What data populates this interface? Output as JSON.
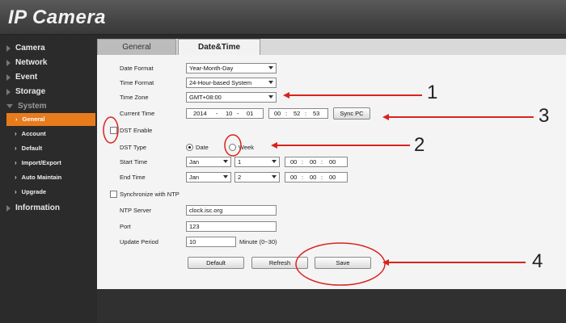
{
  "app": {
    "title": "IP Camera"
  },
  "sidebar": {
    "items": [
      {
        "label": "Camera"
      },
      {
        "label": "Network"
      },
      {
        "label": "Event"
      },
      {
        "label": "Storage"
      },
      {
        "label": "System"
      },
      {
        "label": "Information"
      }
    ],
    "sub_items": [
      {
        "label": "General"
      },
      {
        "label": "Account"
      },
      {
        "label": "Default"
      },
      {
        "label": "Import/Export"
      },
      {
        "label": "Auto Maintain"
      },
      {
        "label": "Upgrade"
      }
    ]
  },
  "tabs": [
    {
      "label": "General"
    },
    {
      "label": "Date&Time"
    }
  ],
  "form": {
    "date_format": {
      "label": "Date Format",
      "value": "Year-Month-Day"
    },
    "time_format": {
      "label": "Time Format",
      "value": "24-Hour-based System"
    },
    "time_zone": {
      "label": "Time Zone",
      "value": "GMT+08:00"
    },
    "current_time": {
      "label": "Current Time",
      "year": "2014",
      "month": "10",
      "day": "01",
      "hour": "00",
      "minute": "52",
      "second": "53",
      "sep_date": "-",
      "sep_time": ":"
    },
    "sync_pc_label": "Sync PC",
    "dst_enable_label": "DST Enable",
    "dst_type": {
      "label": "DST Type",
      "option_date": "Date",
      "option_week": "Week",
      "selected": "Date"
    },
    "start_time": {
      "label": "Start Time",
      "month": "Jan",
      "day": "1",
      "hour": "00",
      "minute": "00",
      "second": "00"
    },
    "end_time": {
      "label": "End Time",
      "month": "Jan",
      "day": "2",
      "hour": "00",
      "minute": "00",
      "second": "00"
    },
    "sync_ntp_label": "Synchronize with NTP",
    "ntp_server": {
      "label": "NTP Server",
      "value": "clock.isc.org"
    },
    "port": {
      "label": "Port",
      "value": "123"
    },
    "update_period": {
      "label": "Update Period",
      "value": "10",
      "unit": "Minute (0~30)"
    }
  },
  "buttons": {
    "default": "Default",
    "refresh": "Refresh",
    "save": "Save"
  },
  "annotations": {
    "n1": "1",
    "n2": "2",
    "n3": "3",
    "n4": "4",
    "color": "#d9231f"
  }
}
